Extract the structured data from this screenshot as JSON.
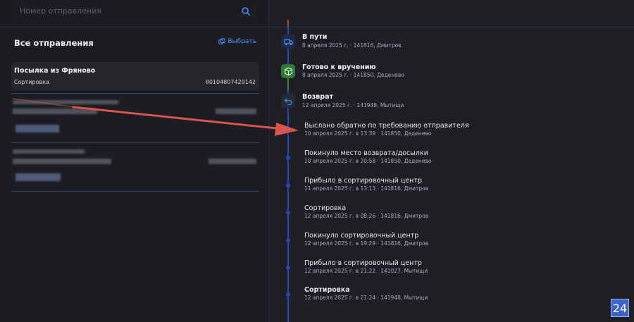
{
  "search": {
    "placeholder": "Номер отправления"
  },
  "left": {
    "title": "Все отправления",
    "choose_label": "Выбрать",
    "active_card": {
      "title": "Посылка из Фряново",
      "status": "Сортировка",
      "number": "80104807429142"
    }
  },
  "stages": [
    {
      "title": "В пути",
      "subtitle": "8 апреля 2025 г. · 141816, Дмитров",
      "icon": "truck-icon"
    },
    {
      "title": "Готово к вручению",
      "subtitle": "8 апреля 2025 г. · 141850, Деденево",
      "icon": "package-icon"
    },
    {
      "title": "Возврат",
      "subtitle": "12 апреля 2025 г. · 141948, Мытищи",
      "icon": "return-icon"
    }
  ],
  "events": [
    {
      "title": "Выслано обратно по требованию отправителя",
      "subtitle": "10 апреля 2025 г. в 13:39 · 141850, Деденево"
    },
    {
      "title": "Покинуло место возврата/досылки",
      "subtitle": "10 апреля 2025 г. в 20:58 · 141850, Деденево"
    },
    {
      "title": "Прибыло в сортировочный центр",
      "subtitle": "11 апреля 2025 г. в 13:13 · 141816, Дмитров"
    },
    {
      "title": "Сортировка",
      "subtitle": "12 апреля 2025 г. в 08:26 · 141816, Дмитров"
    },
    {
      "title": "Покинуло сортировочный центр",
      "subtitle": "12 апреля 2025 г. в 19:29 · 141816, Дмитров"
    },
    {
      "title": "Прибыло в сортировочный центр",
      "subtitle": "12 апреля 2025 г. в 21:22 · 141027, Мытищи"
    },
    {
      "title": "Сортировка",
      "subtitle": "12 апреля 2025 г. в 21:24 · 141948, Мытищи"
    }
  ],
  "watermark": "24",
  "colors": {
    "accent": "#4f8ef7",
    "timeline": "#2447b8",
    "ready": "#2c7b34",
    "arrow": "#d9534f"
  }
}
